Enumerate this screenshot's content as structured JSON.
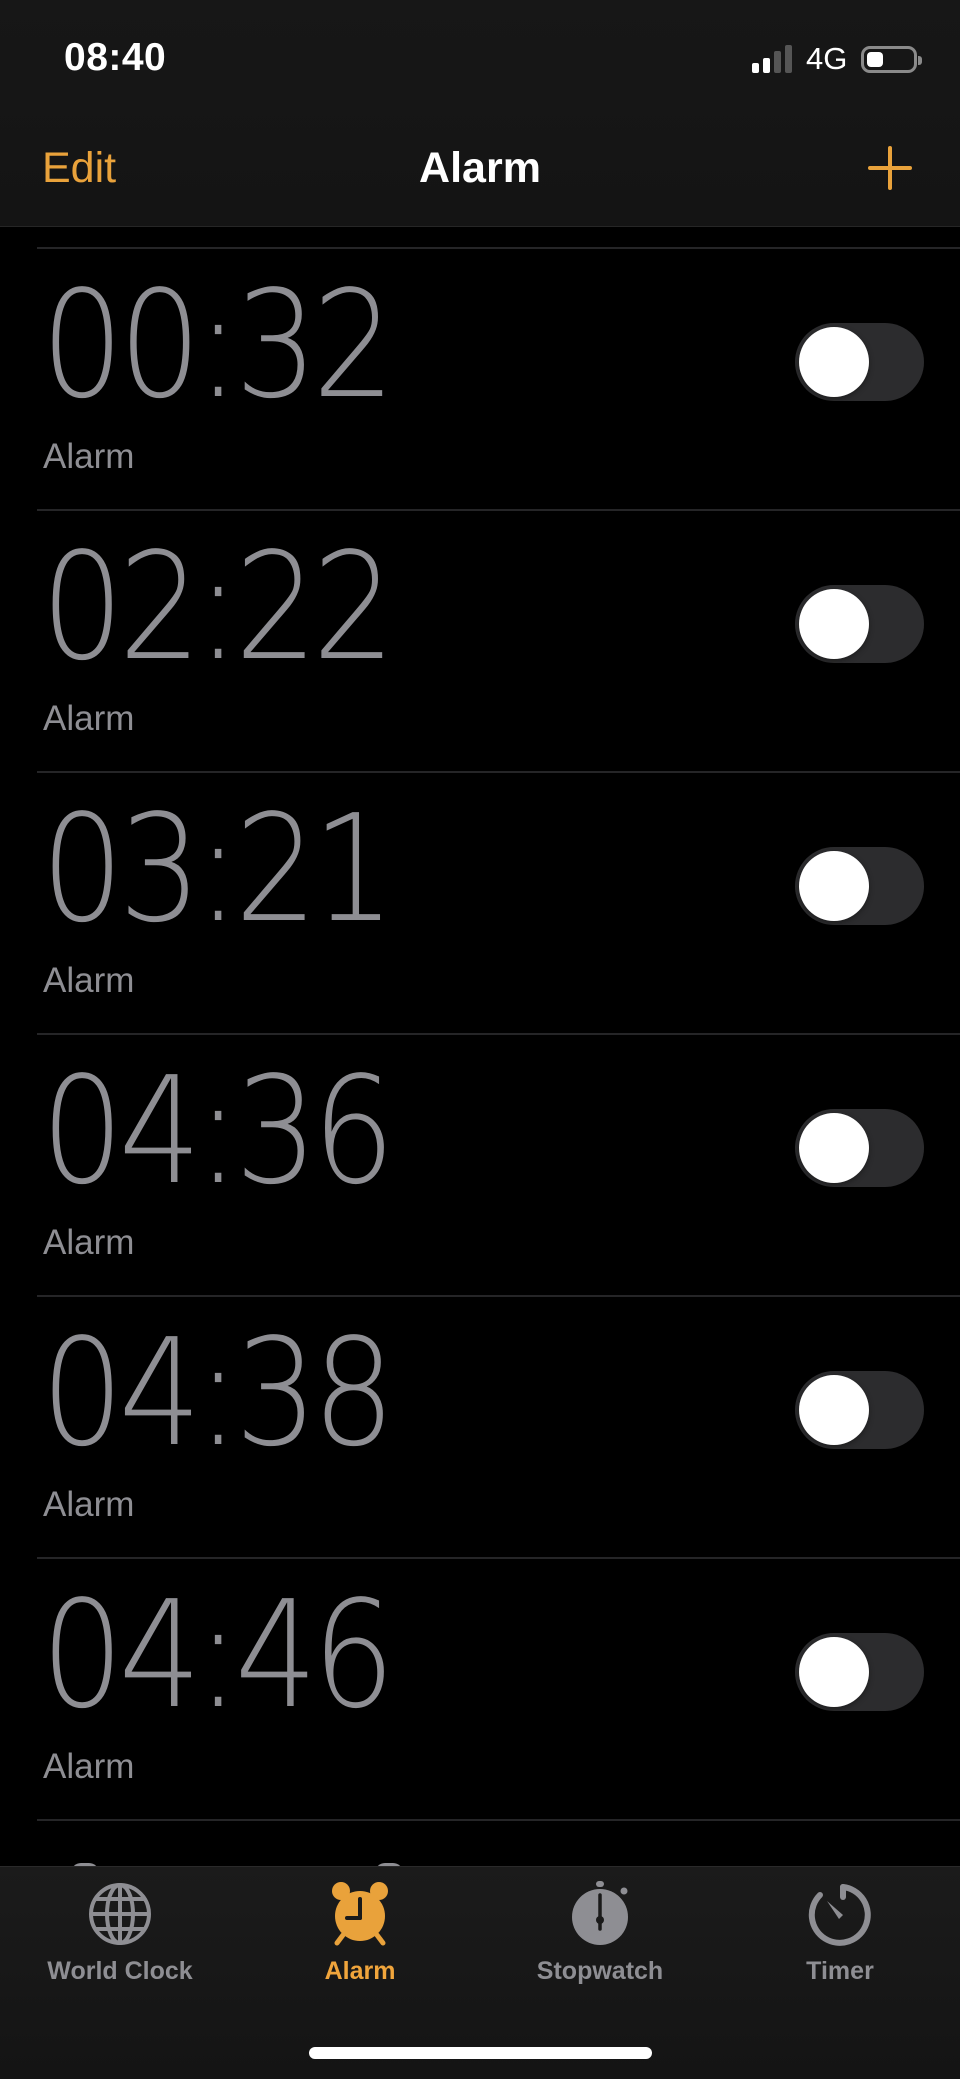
{
  "status_bar": {
    "time": "08:40",
    "signal_bars_filled": 2,
    "signal_bars_total": 4,
    "network": "4G",
    "battery_level": 0.35
  },
  "nav": {
    "edit_label": "Edit",
    "title": "Alarm",
    "add_icon": "plus-icon"
  },
  "alarms": [
    {
      "time": "00:32",
      "label": "Alarm",
      "enabled": false
    },
    {
      "time": "02:22",
      "label": "Alarm",
      "enabled": false
    },
    {
      "time": "03:21",
      "label": "Alarm",
      "enabled": false
    },
    {
      "time": "04:36",
      "label": "Alarm",
      "enabled": false
    },
    {
      "time": "04:38",
      "label": "Alarm",
      "enabled": false
    },
    {
      "time": "04:46",
      "label": "Alarm",
      "enabled": false
    }
  ],
  "tabs": [
    {
      "label": "World Clock",
      "icon": "globe-icon",
      "active": false
    },
    {
      "label": "Alarm",
      "icon": "alarm-clock-icon",
      "active": true
    },
    {
      "label": "Stopwatch",
      "icon": "stopwatch-icon",
      "active": false
    },
    {
      "label": "Timer",
      "icon": "timer-icon",
      "active": false
    }
  ],
  "colors": {
    "accent": "#e9a23b",
    "secondary_text": "#8e8e93",
    "toggle_off_track": "#2c2c2e",
    "background": "#000000"
  }
}
